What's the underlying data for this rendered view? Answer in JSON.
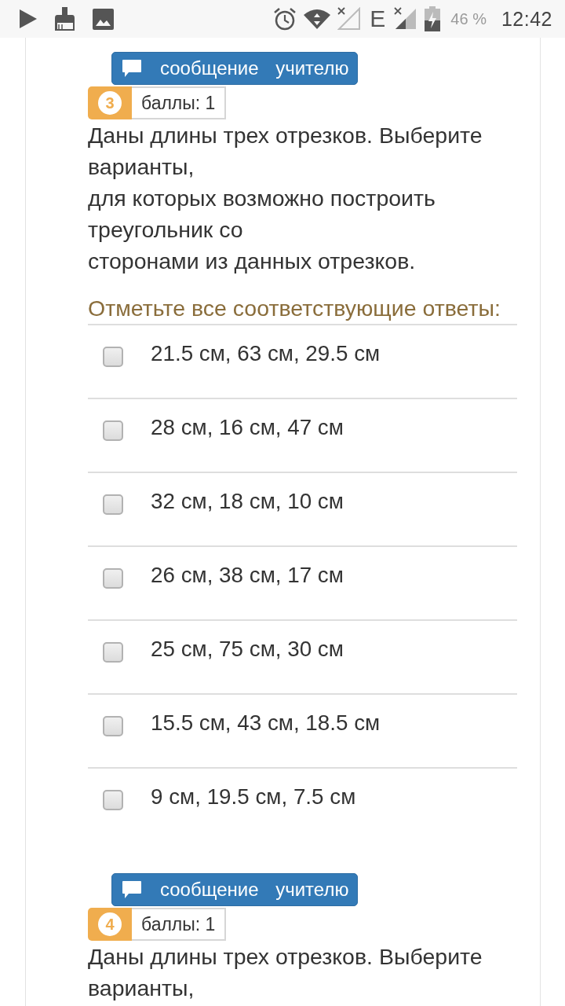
{
  "status_bar": {
    "network": "E",
    "battery": "46 %",
    "time": "12:42"
  },
  "questions": [
    {
      "message_button": "сообщение учителю",
      "number": "3",
      "points": "баллы: 1",
      "text": "Даны длины трех отрезков. Выберите варианты,\nдля которых возможно построить треугольник со\nсторонами из данных отрезков.",
      "prompt": "Отметьте все соответствующие ответы:",
      "options": [
        {
          "label": "21.5 см, 63 см, 29.5 см",
          "checked": false
        },
        {
          "label": "28 см, 16 см, 47 см",
          "checked": false
        },
        {
          "label": "32 см, 18 см, 10 см",
          "checked": false
        },
        {
          "label": "26 см, 38 см, 17 см",
          "checked": false
        },
        {
          "label": "25 см, 75 см, 30 см",
          "checked": false
        },
        {
          "label": "15.5 см, 43 см, 18.5 см",
          "checked": false
        },
        {
          "label": "9 см, 19.5 см, 7.5 см",
          "checked": false
        }
      ]
    },
    {
      "message_button": "сообщение учителю",
      "number": "4",
      "points": "баллы: 1",
      "text": "Даны длины трех отрезков. Выберите варианты,"
    }
  ]
}
